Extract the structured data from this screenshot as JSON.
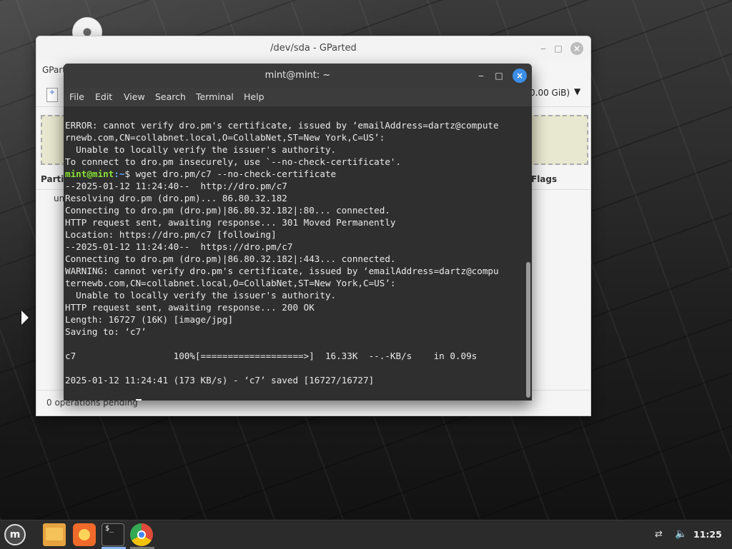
{
  "gparted": {
    "title": "/dev/sda - GParted",
    "menu_partial": "GParte",
    "device_size": "0.00 GiB)",
    "col_partition": "Parti",
    "col_flags": "Flags",
    "row_partial": "un",
    "status": "0 operations pending"
  },
  "terminal": {
    "title": "mint@mint: ~",
    "menu": [
      "File",
      "Edit",
      "View",
      "Search",
      "Terminal",
      "Help"
    ],
    "lines_before_prompt": [
      "ERROR: cannot verify dro.pm's certificate, issued by ‘emailAddress=dartz@compute",
      "rnewb.com,CN=collabnet.local,O=CollabNet,ST=New York,C=US’:",
      "  Unable to locally verify the issuer's authority.",
      "To connect to dro.pm insecurely, use `--no-check-certificate'."
    ],
    "prompt_user": "mint@mint",
    "prompt_path": ":~",
    "prompt_sym": "$ ",
    "command": "wget dro.pm/c7 --no-check-certificate",
    "output_lines": [
      "--2025-01-12 11:24:40--  http://dro.pm/c7",
      "Resolving dro.pm (dro.pm)... 86.80.32.182",
      "Connecting to dro.pm (dro.pm)|86.80.32.182|:80... connected.",
      "HTTP request sent, awaiting response... 301 Moved Permanently",
      "Location: https://dro.pm/c7 [following]",
      "--2025-01-12 11:24:40--  https://dro.pm/c7",
      "Connecting to dro.pm (dro.pm)|86.80.32.182|:443... connected.",
      "WARNING: cannot verify dro.pm's certificate, issued by ‘emailAddress=dartz@compu",
      "ternewb.com,CN=collabnet.local,O=CollabNet,ST=New York,C=US’:",
      "  Unable to locally verify the issuer's authority.",
      "HTTP request sent, awaiting response... 200 OK",
      "Length: 16727 (16K) [image/jpg]",
      "Saving to: ‘c7’",
      "",
      "c7                  100%[===================>]  16.33K  --.-KB/s    in 0.09s",
      "",
      "2025-01-12 11:24:41 (173 KB/s) - ‘c7’ saved [16727/16727]",
      ""
    ]
  },
  "taskbar": {
    "menu_icon": "mint-logo-icon",
    "terminal_icon_text": "$_",
    "clock": "11:25"
  }
}
